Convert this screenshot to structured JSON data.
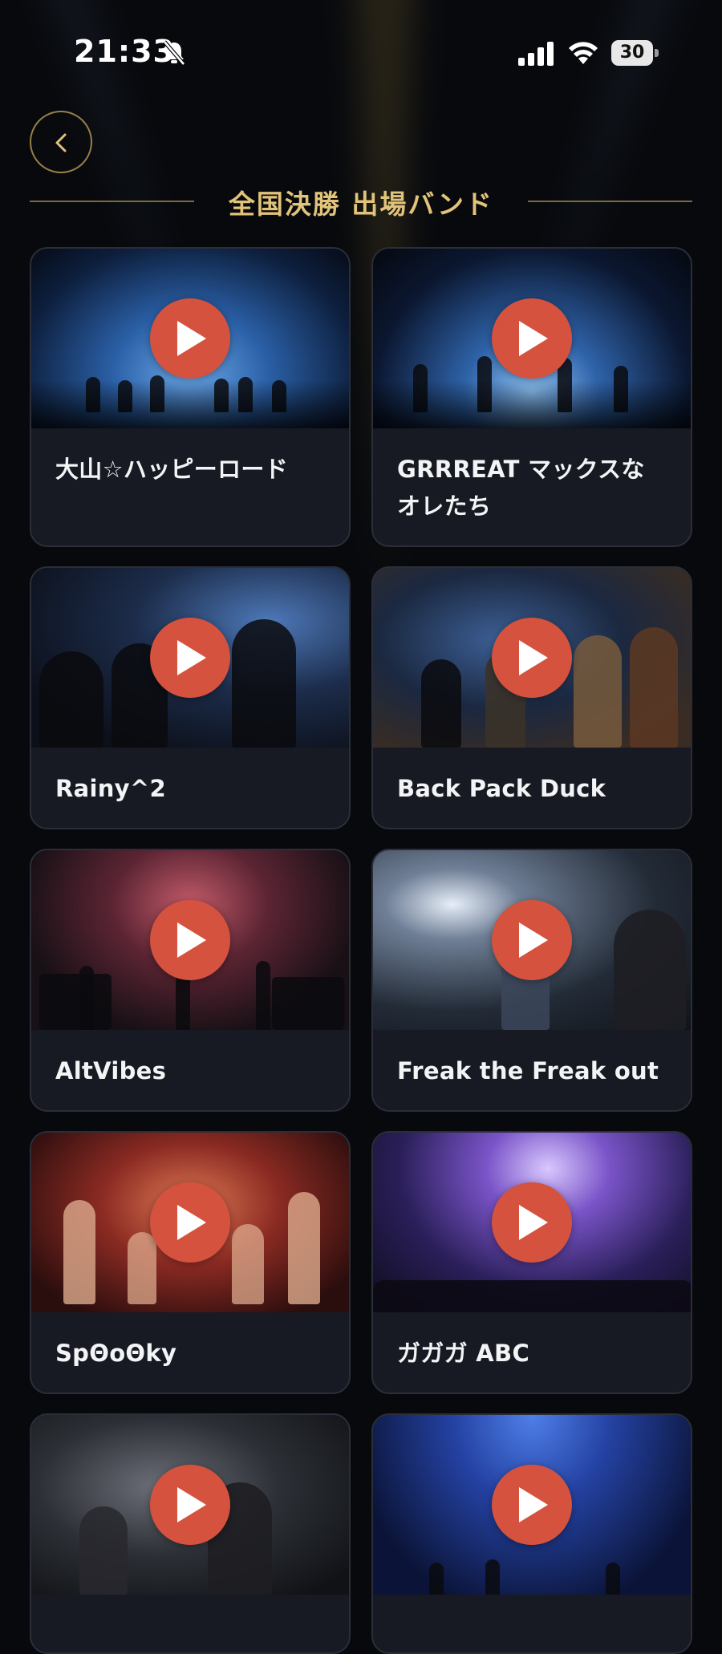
{
  "status_bar": {
    "time": "21:33",
    "battery": "30"
  },
  "header": {
    "title": "全国決勝 出場バンド"
  },
  "bands": [
    {
      "name": "大山☆ハッピーロード"
    },
    {
      "name": "GRRREAT マックスなオレたち"
    },
    {
      "name": "Rainy^2"
    },
    {
      "name": "Back Pack Duck"
    },
    {
      "name": "AltVibes"
    },
    {
      "name": "Freak the Freak out"
    },
    {
      "name": "SpΘoΘky"
    },
    {
      "name": "ガガガ ABC"
    },
    {
      "name": ""
    },
    {
      "name": ""
    }
  ],
  "colors": {
    "accent_gold": "#e1c37a",
    "play_button": "#d5523f",
    "card_bg": "#171a22"
  },
  "icons": {
    "back": "chevron-left-icon",
    "play": "play-icon"
  }
}
